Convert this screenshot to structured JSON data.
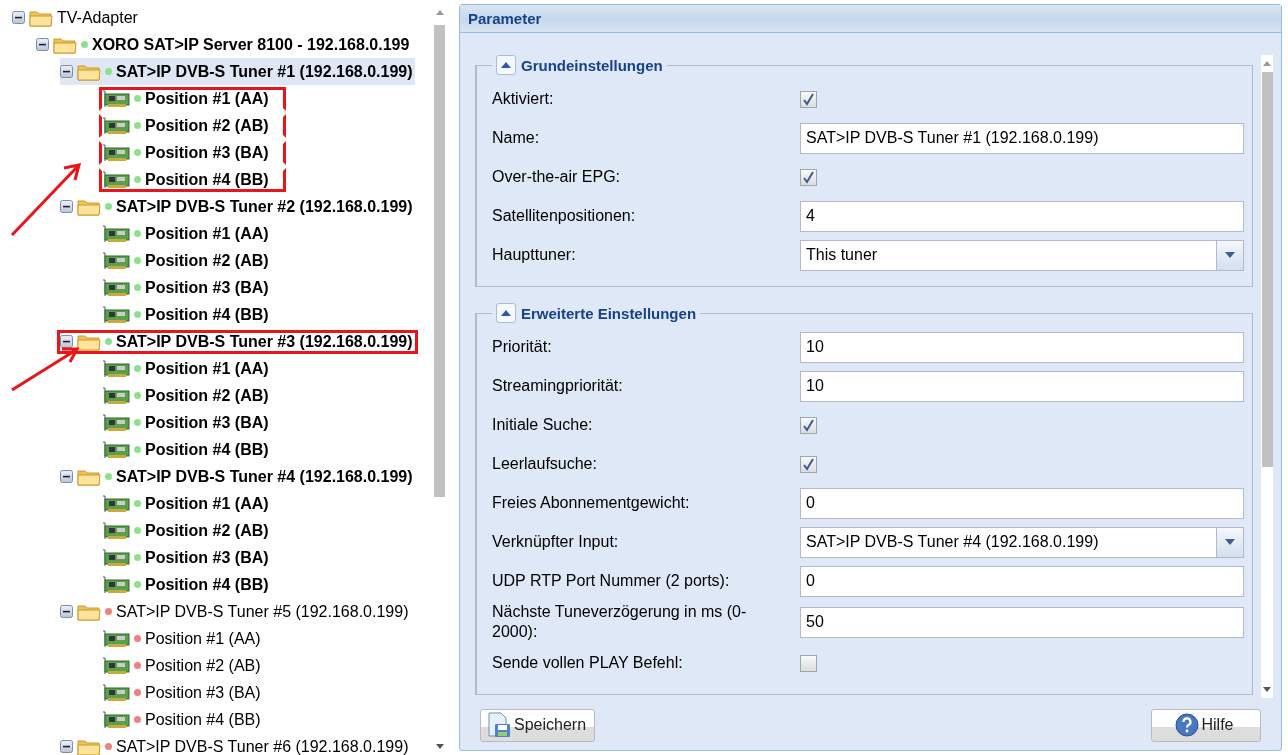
{
  "tree": {
    "label": "TV-Adapter",
    "expanded": true,
    "children": [
      {
        "label": "XORO SAT>IP Server 8100 - 192.168.0.199",
        "expanded": true,
        "active": true,
        "color": "#8ee08e",
        "children": [
          {
            "label": "SAT>IP DVB-S Tuner #1 (192.168.0.199)",
            "expanded": true,
            "active": true,
            "color": "#8ee08e",
            "selected": true,
            "highlighted": false,
            "children": [
              {
                "label": "Position #1 (AA)",
                "active": true,
                "color": "#8ee08e",
                "highlighted": true
              },
              {
                "label": "Position #2 (AB)",
                "active": true,
                "color": "#8ee08e",
                "highlighted": true
              },
              {
                "label": "Position #3 (BA)",
                "active": true,
                "color": "#8ee08e",
                "highlighted": true
              },
              {
                "label": "Position #4 (BB)",
                "active": true,
                "color": "#8ee08e",
                "highlighted": true
              }
            ]
          },
          {
            "label": "SAT>IP DVB-S Tuner #2 (192.168.0.199)",
            "expanded": true,
            "active": true,
            "color": "#8ee08e",
            "selected": false,
            "highlighted": false,
            "children": [
              {
                "label": "Position #1 (AA)",
                "active": true,
                "color": "#8ee08e",
                "highlighted": false
              },
              {
                "label": "Position #2 (AB)",
                "active": true,
                "color": "#8ee08e",
                "highlighted": false
              },
              {
                "label": "Position #3 (BA)",
                "active": true,
                "color": "#8ee08e",
                "highlighted": false
              },
              {
                "label": "Position #4 (BB)",
                "active": true,
                "color": "#8ee08e",
                "highlighted": false
              }
            ]
          },
          {
            "label": "SAT>IP DVB-S Tuner #3 (192.168.0.199)",
            "expanded": true,
            "active": true,
            "color": "#8ee08e",
            "selected": false,
            "highlighted": true,
            "children": [
              {
                "label": "Position #1 (AA)",
                "active": true,
                "color": "#8ee08e",
                "highlighted": false
              },
              {
                "label": "Position #2 (AB)",
                "active": true,
                "color": "#8ee08e",
                "highlighted": false
              },
              {
                "label": "Position #3 (BA)",
                "active": true,
                "color": "#8ee08e",
                "highlighted": false
              },
              {
                "label": "Position #4 (BB)",
                "active": true,
                "color": "#8ee08e",
                "highlighted": false
              }
            ]
          },
          {
            "label": "SAT>IP DVB-S Tuner #4 (192.168.0.199)",
            "expanded": true,
            "active": true,
            "color": "#8ee08e",
            "selected": false,
            "highlighted": false,
            "children": [
              {
                "label": "Position #1 (AA)",
                "active": true,
                "color": "#8ee08e",
                "highlighted": false
              },
              {
                "label": "Position #2 (AB)",
                "active": true,
                "color": "#8ee08e",
                "highlighted": false
              },
              {
                "label": "Position #3 (BA)",
                "active": true,
                "color": "#8ee08e",
                "highlighted": false
              },
              {
                "label": "Position #4 (BB)",
                "active": true,
                "color": "#8ee08e",
                "highlighted": false
              }
            ]
          },
          {
            "label": "SAT>IP DVB-S Tuner #5 (192.168.0.199)",
            "expanded": true,
            "active": false,
            "color": "#f08080",
            "selected": false,
            "highlighted": false,
            "children": [
              {
                "label": "Position #1 (AA)",
                "active": false,
                "color": "#f08080",
                "highlighted": false
              },
              {
                "label": "Position #2 (AB)",
                "active": false,
                "color": "#f08080",
                "highlighted": false
              },
              {
                "label": "Position #3 (BA)",
                "active": false,
                "color": "#f08080",
                "highlighted": false
              },
              {
                "label": "Position #4 (BB)",
                "active": false,
                "color": "#f08080",
                "highlighted": false
              }
            ]
          },
          {
            "label": "SAT>IP DVB-S Tuner #6 (192.168.0.199)",
            "expanded": true,
            "active": false,
            "color": "#f08080",
            "selected": false,
            "highlighted": false
          }
        ]
      }
    ]
  },
  "panel": {
    "title": "Parameter",
    "sections": [
      {
        "title": "Grundeinstellungen",
        "expanded": true,
        "fields": [
          {
            "kind": "checkbox",
            "label": "Aktiviert:",
            "checked": true
          },
          {
            "kind": "text",
            "label": "Name:",
            "value": "SAT>IP DVB-S Tuner #1 (192.168.0.199)"
          },
          {
            "kind": "checkbox",
            "label": "Over-the-air EPG:",
            "checked": true
          },
          {
            "kind": "text",
            "label": "Satellitenpositionen:",
            "value": "4"
          },
          {
            "kind": "select",
            "label": "Haupttuner:",
            "value": "This tuner"
          }
        ]
      },
      {
        "title": "Erweiterte Einstellungen",
        "expanded": true,
        "fields": [
          {
            "kind": "text",
            "label": "Priorität:",
            "value": "10"
          },
          {
            "kind": "text",
            "label": "Streamingpriorität:",
            "value": "10"
          },
          {
            "kind": "checkbox",
            "label": "Initiale Suche:",
            "checked": true
          },
          {
            "kind": "checkbox",
            "label": "Leerlaufsuche:",
            "checked": true
          },
          {
            "kind": "text",
            "label": "Freies Abonnementgewicht:",
            "value": "0"
          },
          {
            "kind": "select",
            "label": "Verknüpfter Input:",
            "value": "SAT>IP DVB-S Tuner #4 (192.168.0.199)"
          },
          {
            "kind": "text",
            "label": "UDP RTP Port Nummer (2 ports):",
            "value": "0"
          },
          {
            "kind": "text",
            "label": "Nächste Tuneverzögerung in ms (0-2000):",
            "value": "50"
          },
          {
            "kind": "checkbox",
            "label": "Sende vollen PLAY Befehl:",
            "checked": false
          }
        ]
      }
    ]
  },
  "buttons": [
    {
      "kind": "save",
      "label": "Speichern"
    },
    {
      "kind": "help",
      "label": "Hilfe"
    }
  ]
}
